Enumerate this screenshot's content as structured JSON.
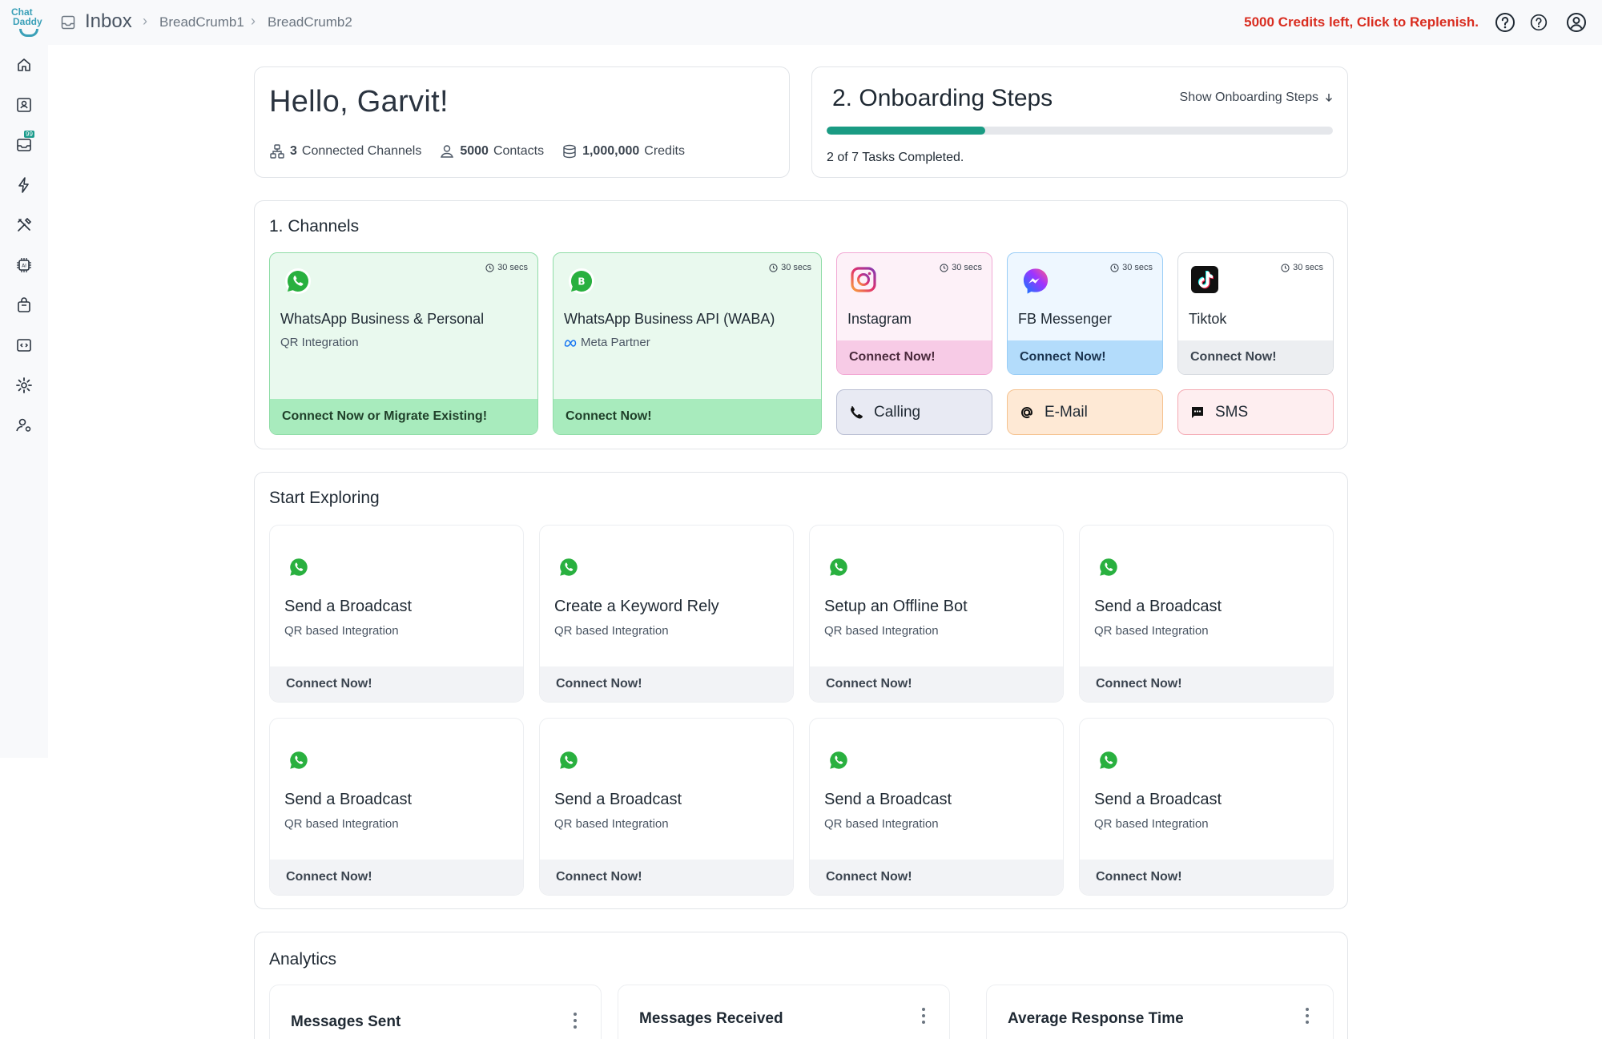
{
  "app": {
    "logo_line1": "Chat",
    "logo_line2": "Daddy",
    "page_title": "Inbox",
    "breadcrumbs": [
      "BreadCrumb1",
      "BreadCrumb2"
    ],
    "credits_notice": "5000 Credits left, Click to Replenish.",
    "accent_color": "#1a9b83",
    "alert_color": "#d92d20"
  },
  "sidebar": {
    "items": [
      {
        "icon": "home-icon"
      },
      {
        "icon": "contacts-icon"
      },
      {
        "icon": "inbox-icon",
        "badge": "99"
      },
      {
        "icon": "lightning-icon"
      },
      {
        "icon": "tools-icon"
      },
      {
        "icon": "ai-chip-icon"
      },
      {
        "icon": "bag-icon"
      },
      {
        "icon": "code-icon"
      },
      {
        "icon": "settings-icon"
      },
      {
        "icon": "user-settings-icon"
      }
    ]
  },
  "hello": {
    "greeting": "Hello, Garvit!",
    "channels_count": "3",
    "channels_label": "Connected Channels",
    "contacts_count": "5000",
    "contacts_label": "Contacts",
    "credits_count": "1,000,000",
    "credits_label": "Credits"
  },
  "onboarding": {
    "title": "2. Onboarding Steps",
    "toggle_label": "Show Onboarding Steps",
    "tasks_text": "2 of 7 Tasks Completed.",
    "progress_fraction": 0.3125
  },
  "channels": {
    "title": "1. Channels",
    "cards": [
      {
        "name": "WhatsApp Business & Personal",
        "sub": "QR Integration",
        "timer": "30 secs",
        "cta": "Connect Now or Migrate Existing!",
        "icon": "whatsapp-icon"
      },
      {
        "name": "WhatsApp Business API (WABA)",
        "sub": "Meta Partner",
        "timer": "30 secs",
        "cta": "Connect Now!",
        "icon": "whatsapp-business-icon"
      },
      {
        "name": "Instagram",
        "timer": "30 secs",
        "cta": "Connect Now!",
        "icon": "instagram-icon"
      },
      {
        "name": "FB Messenger",
        "timer": "30 secs",
        "cta": "Connect Now!",
        "icon": "messenger-icon"
      },
      {
        "name": "Tiktok",
        "timer": "30 secs",
        "cta": "Connect Now!",
        "icon": "tiktok-icon"
      }
    ],
    "mini": [
      {
        "label": "Calling",
        "icon": "phone-icon"
      },
      {
        "label": "E-Mail",
        "icon": "at-icon"
      },
      {
        "label": "SMS",
        "icon": "sms-icon"
      }
    ]
  },
  "explore": {
    "title": "Start Exploring",
    "cards": [
      {
        "title": "Send a Broadcast",
        "sub": "QR based Integration",
        "cta": "Connect Now!"
      },
      {
        "title": "Create a Keyword Rely",
        "sub": "QR based Integration",
        "cta": "Connect Now!"
      },
      {
        "title": "Setup an Offline Bot",
        "sub": "QR based Integration",
        "cta": "Connect Now!"
      },
      {
        "title": "Send a Broadcast",
        "sub": "QR based Integration",
        "cta": "Connect Now!"
      },
      {
        "title": "Send a Broadcast",
        "sub": "QR based Integration",
        "cta": "Connect Now!"
      },
      {
        "title": "Send a Broadcast",
        "sub": "QR based Integration",
        "cta": "Connect Now!"
      },
      {
        "title": "Send a Broadcast",
        "sub": "QR based Integration",
        "cta": "Connect Now!"
      },
      {
        "title": "Send a Broadcast",
        "sub": "QR based Integration",
        "cta": "Connect Now!"
      }
    ]
  },
  "analytics": {
    "title": "Analytics",
    "cards": [
      {
        "title": "Messages Sent"
      },
      {
        "title": "Messages Received"
      },
      {
        "title": "Average Response Time"
      }
    ]
  }
}
